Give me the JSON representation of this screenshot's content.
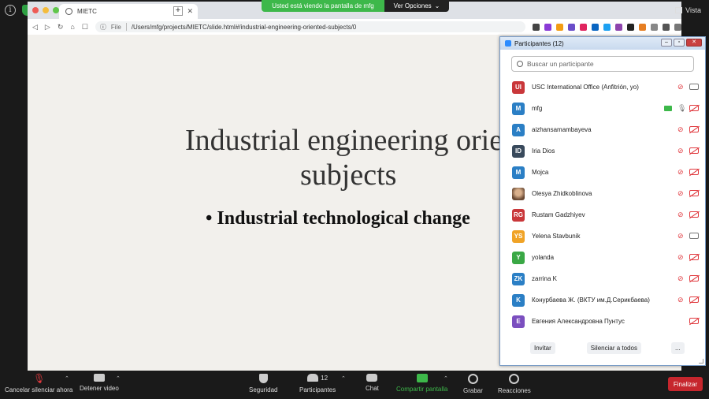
{
  "share_banner": {
    "message": "Usted está viendo la pantalla de mfg",
    "options_label": "Ver Opciones"
  },
  "view_label": "Vista",
  "browser": {
    "tab_title": "MIETC",
    "url_scheme": "File",
    "url": "/Users/mfg/projects/MIETC/slide.html#/industrial-engineering-oriented-subjects/0"
  },
  "slide": {
    "title_line1": "Industrial engineering oriented",
    "title_line2": "subjects",
    "bullet": "Industrial technological change"
  },
  "participants_panel": {
    "title": "Participantes (12)",
    "search_placeholder": "Buscar un participante",
    "participants": [
      {
        "initials": "UI",
        "name": "USC International Office (Anfitrión, yo)",
        "color": "#c9373a",
        "mic": "muted",
        "cam": "on"
      },
      {
        "initials": "M",
        "name": "mfg",
        "color": "#2b7fc5",
        "mic": "on",
        "cam": "off",
        "sharing": true
      },
      {
        "initials": "A",
        "name": "aizhansamambayeva",
        "color": "#2b7fc5",
        "mic": "muted",
        "cam": "off"
      },
      {
        "initials": "ID",
        "name": "Iria Dios",
        "color": "#394a5c",
        "mic": "muted",
        "cam": "off"
      },
      {
        "initials": "M",
        "name": "Mojca",
        "color": "#2b7fc5",
        "mic": "muted",
        "cam": "off"
      },
      {
        "initials": "",
        "name": "Olesya Zhidkoblinova",
        "color": "#8a6a55",
        "mic": "muted",
        "cam": "off",
        "photo": true
      },
      {
        "initials": "RG",
        "name": "Rustam Gadzhiyev",
        "color": "#c9373a",
        "mic": "muted",
        "cam": "off"
      },
      {
        "initials": "YS",
        "name": "Yelena Stavbunik",
        "color": "#f0a326",
        "mic": "muted",
        "cam": "on"
      },
      {
        "initials": "Y",
        "name": "yolanda",
        "color": "#3aa845",
        "mic": "muted",
        "cam": "off"
      },
      {
        "initials": "ZK",
        "name": "zarrina K",
        "color": "#2b7fc5",
        "mic": "muted",
        "cam": "off"
      },
      {
        "initials": "K",
        "name": "Конурбаева Ж. (ВКТУ им.Д.Серикбаева)",
        "color": "#2b7fc5",
        "mic": "muted",
        "cam": "off"
      },
      {
        "initials": "E",
        "name": "Евгения Александровна Пунтус",
        "color": "#7b4fbf",
        "mic": "none",
        "cam": "off"
      }
    ],
    "invite_label": "Invitar",
    "mute_all_label": "Silenciar a todos",
    "more_label": "..."
  },
  "toolbar": {
    "unmute_label": "Cancelar silenciar ahora",
    "stop_video_label": "Detener video",
    "security_label": "Seguridad",
    "participants_label": "Participantes",
    "participants_count": "12",
    "chat_label": "Chat",
    "share_screen_label": "Compartir pantalla",
    "record_label": "Grabar",
    "reactions_label": "Reacciones",
    "end_label": "Finalizar"
  }
}
